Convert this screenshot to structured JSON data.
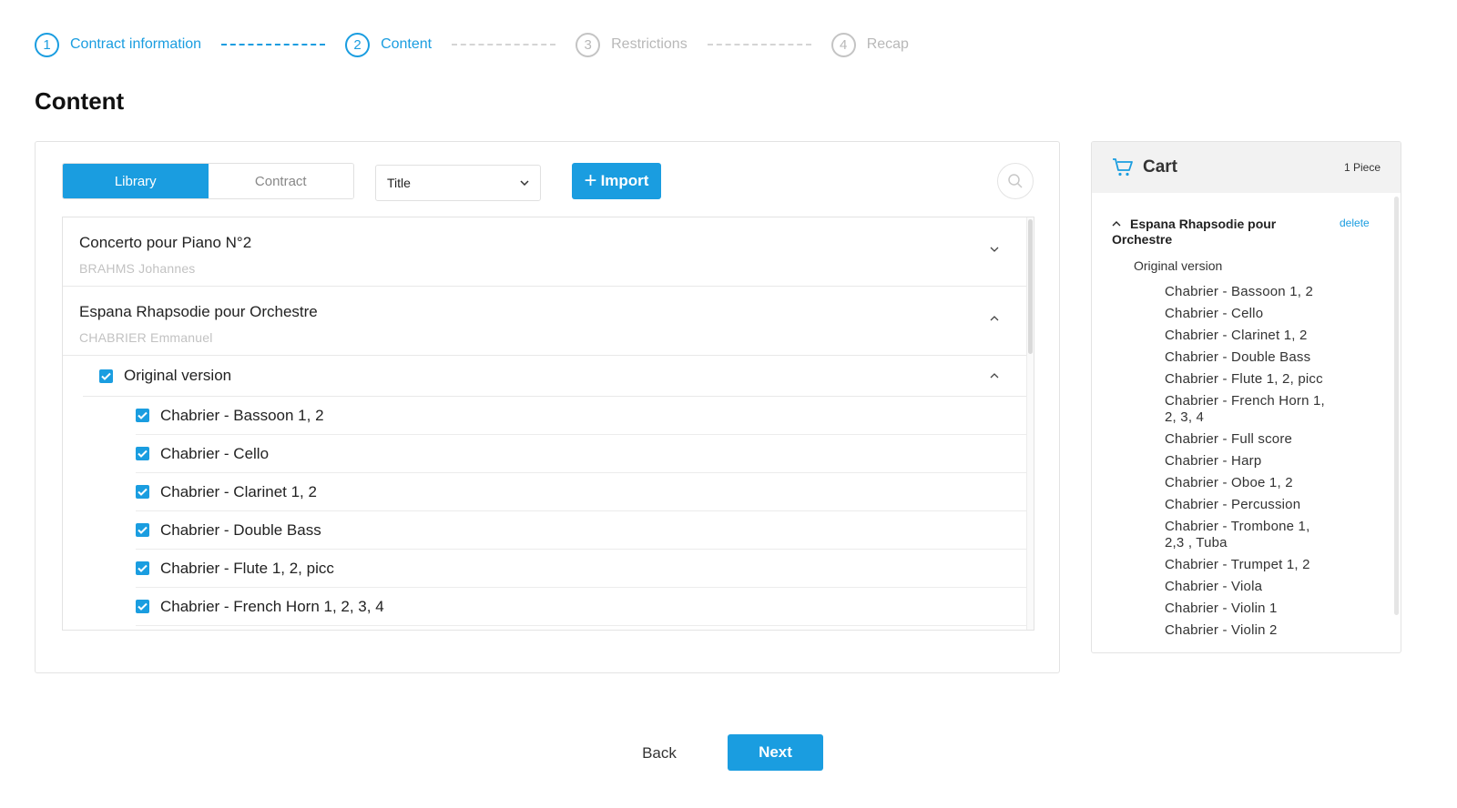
{
  "stepper": [
    {
      "num": "1",
      "label": "Contract information"
    },
    {
      "num": "2",
      "label": "Content"
    },
    {
      "num": "3",
      "label": "Restrictions"
    },
    {
      "num": "4",
      "label": "Recap"
    }
  ],
  "page_title": "Content",
  "toolbar": {
    "tab_library": "Library",
    "tab_contract": "Contract",
    "sort_value": "Title",
    "import_label": "Import"
  },
  "works": [
    {
      "title": "Concerto pour Piano N°2",
      "composer": "BRAHMS Johannes"
    },
    {
      "title": "Espana Rhapsodie pour Orchestre",
      "composer": "CHABRIER Emmanuel"
    }
  ],
  "version": {
    "label": "Original version"
  },
  "parts": [
    "Chabrier - Bassoon 1, 2",
    "Chabrier - Cello",
    "Chabrier - Clarinet 1, 2",
    "Chabrier - Double Bass",
    "Chabrier - Flute 1, 2, picc",
    "Chabrier - French Horn 1, 2, 3, 4"
  ],
  "cart": {
    "title": "Cart",
    "count": "1 Piece",
    "work_title": "Espana Rhapsodie pour Orchestre",
    "delete_label": "delete",
    "version_label": "Original version",
    "parts": [
      "Chabrier - Bassoon 1, 2",
      "Chabrier - Cello",
      "Chabrier - Clarinet 1, 2",
      "Chabrier - Double Bass",
      "Chabrier - Flute 1, 2, picc",
      "Chabrier - French Horn 1, 2, 3, 4",
      "Chabrier - Full score",
      "Chabrier - Harp",
      "Chabrier - Oboe 1, 2",
      "Chabrier - Percussion",
      "Chabrier - Trombone 1, 2,3 , Tuba",
      "Chabrier - Trumpet 1, 2",
      "Chabrier - Viola",
      "Chabrier - Violin 1",
      "Chabrier - Violin 2"
    ]
  },
  "footer": {
    "back_label": "Back",
    "next_label": "Next"
  },
  "colors": {
    "accent": "#1a9de0",
    "muted": "#b8b8b8"
  }
}
